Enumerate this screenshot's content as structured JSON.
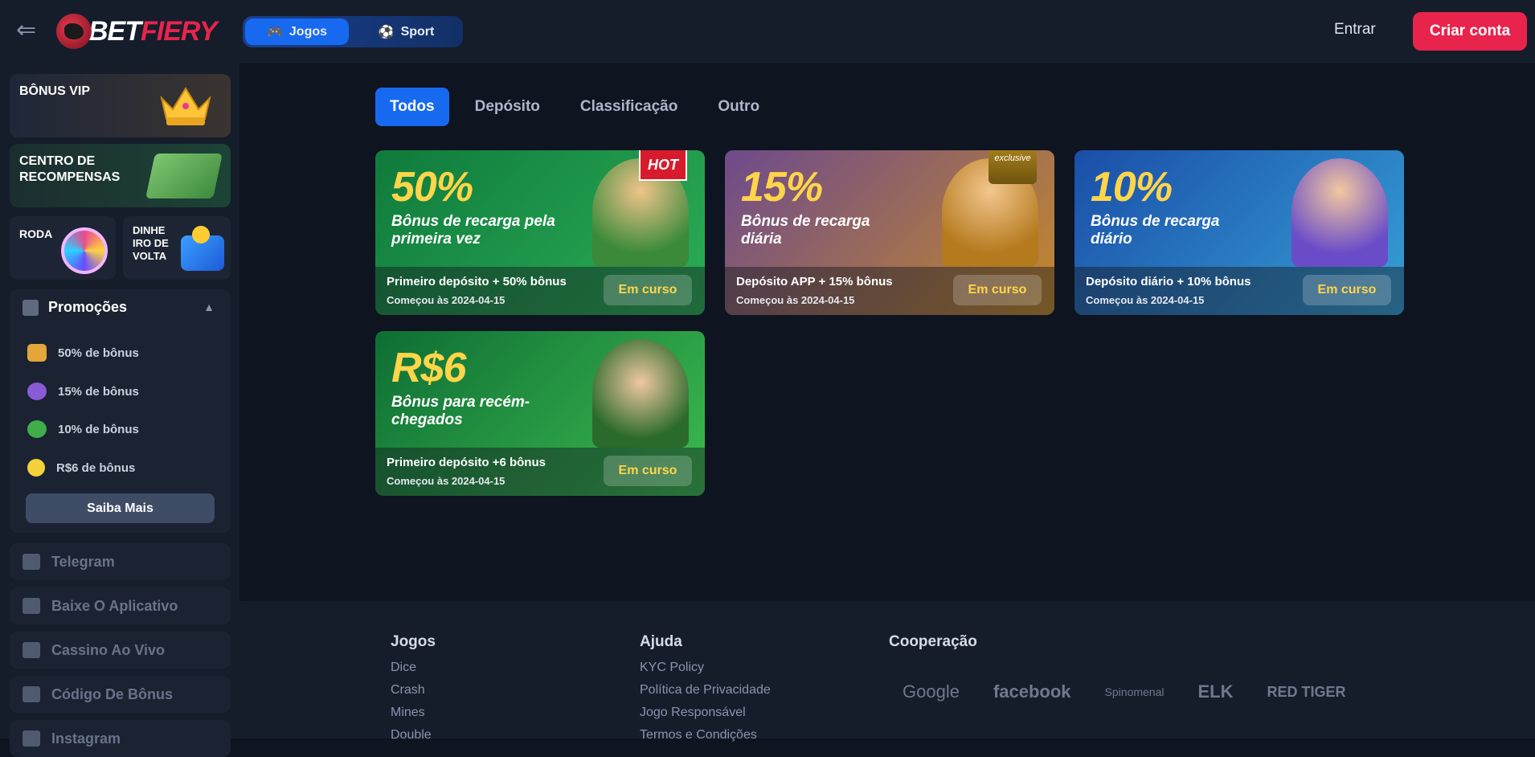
{
  "header": {
    "logo_part1": "BET",
    "logo_part2": "FIERY",
    "mode_games": "Jogos",
    "mode_sport": "Sport",
    "login": "Entrar",
    "register": "Criar conta"
  },
  "sidebar": {
    "vip": "BÔNUS VIP",
    "rewards": "CENTRO DE RECOMPENSAS",
    "wheel": "RODA",
    "cashback_l1": "DINHE",
    "cashback_l2": "IRO DE",
    "cashback_l3": "VOLTA",
    "promotions_title": "Promoções",
    "promotions": [
      {
        "label": "50% de bônus",
        "color": "#e2a63a"
      },
      {
        "label": "15% de bônus",
        "color": "#8a5bd6"
      },
      {
        "label": "10% de bônus",
        "color": "#3fae4b"
      },
      {
        "label": "R$6 de bônus",
        "color": "#f5d23a"
      }
    ],
    "learn_more": "Saiba Mais",
    "links": [
      "Telegram",
      "Baixe O Aplicativo",
      "Cassino Ao Vivo",
      "Código De Bônus",
      "Instagram"
    ]
  },
  "tabs": [
    "Todos",
    "Depósito",
    "Classificação",
    "Outro"
  ],
  "cards": [
    {
      "pct": "50%",
      "subtitle": "Bônus de recarga pela primeira vez",
      "condition": "Primeiro depósito + 50% bônus",
      "date": "Começou às 2024-04-15",
      "status": "Em curso",
      "badge": "HOT"
    },
    {
      "pct": "15%",
      "subtitle": "Bônus de recarga diária",
      "condition": "Depósito APP + 15% bônus",
      "date": "Começou às 2024-04-15",
      "status": "Em curso",
      "badge": "exclusive"
    },
    {
      "pct": "10%",
      "subtitle": "Bônus de recarga diário",
      "condition": "Depósito diário + 10% bônus",
      "date": "Começou às 2024-04-15",
      "status": "Em curso",
      "badge": ""
    },
    {
      "pct": "R$6",
      "subtitle": "Bônus para recém-chegados",
      "condition": "Primeiro depósito +6 bônus",
      "date": "Começou às 2024-04-15",
      "status": "Em curso",
      "badge": ""
    }
  ],
  "footer": {
    "games_title": "Jogos",
    "games": [
      "Dice",
      "Crash",
      "Mines",
      "Double"
    ],
    "help_title": "Ajuda",
    "help": [
      "KYC Policy",
      "Política de Privacidade",
      "Jogo Responsável",
      "Termos e Condições"
    ],
    "coop_title": "Cooperação",
    "partners": [
      "Google",
      "facebook",
      "Spinomenal",
      "ELK",
      "RED TIGER"
    ]
  },
  "colors": {
    "accent": "#1769f0",
    "brand": "#e8244c",
    "status_text": "#ffd54a"
  }
}
